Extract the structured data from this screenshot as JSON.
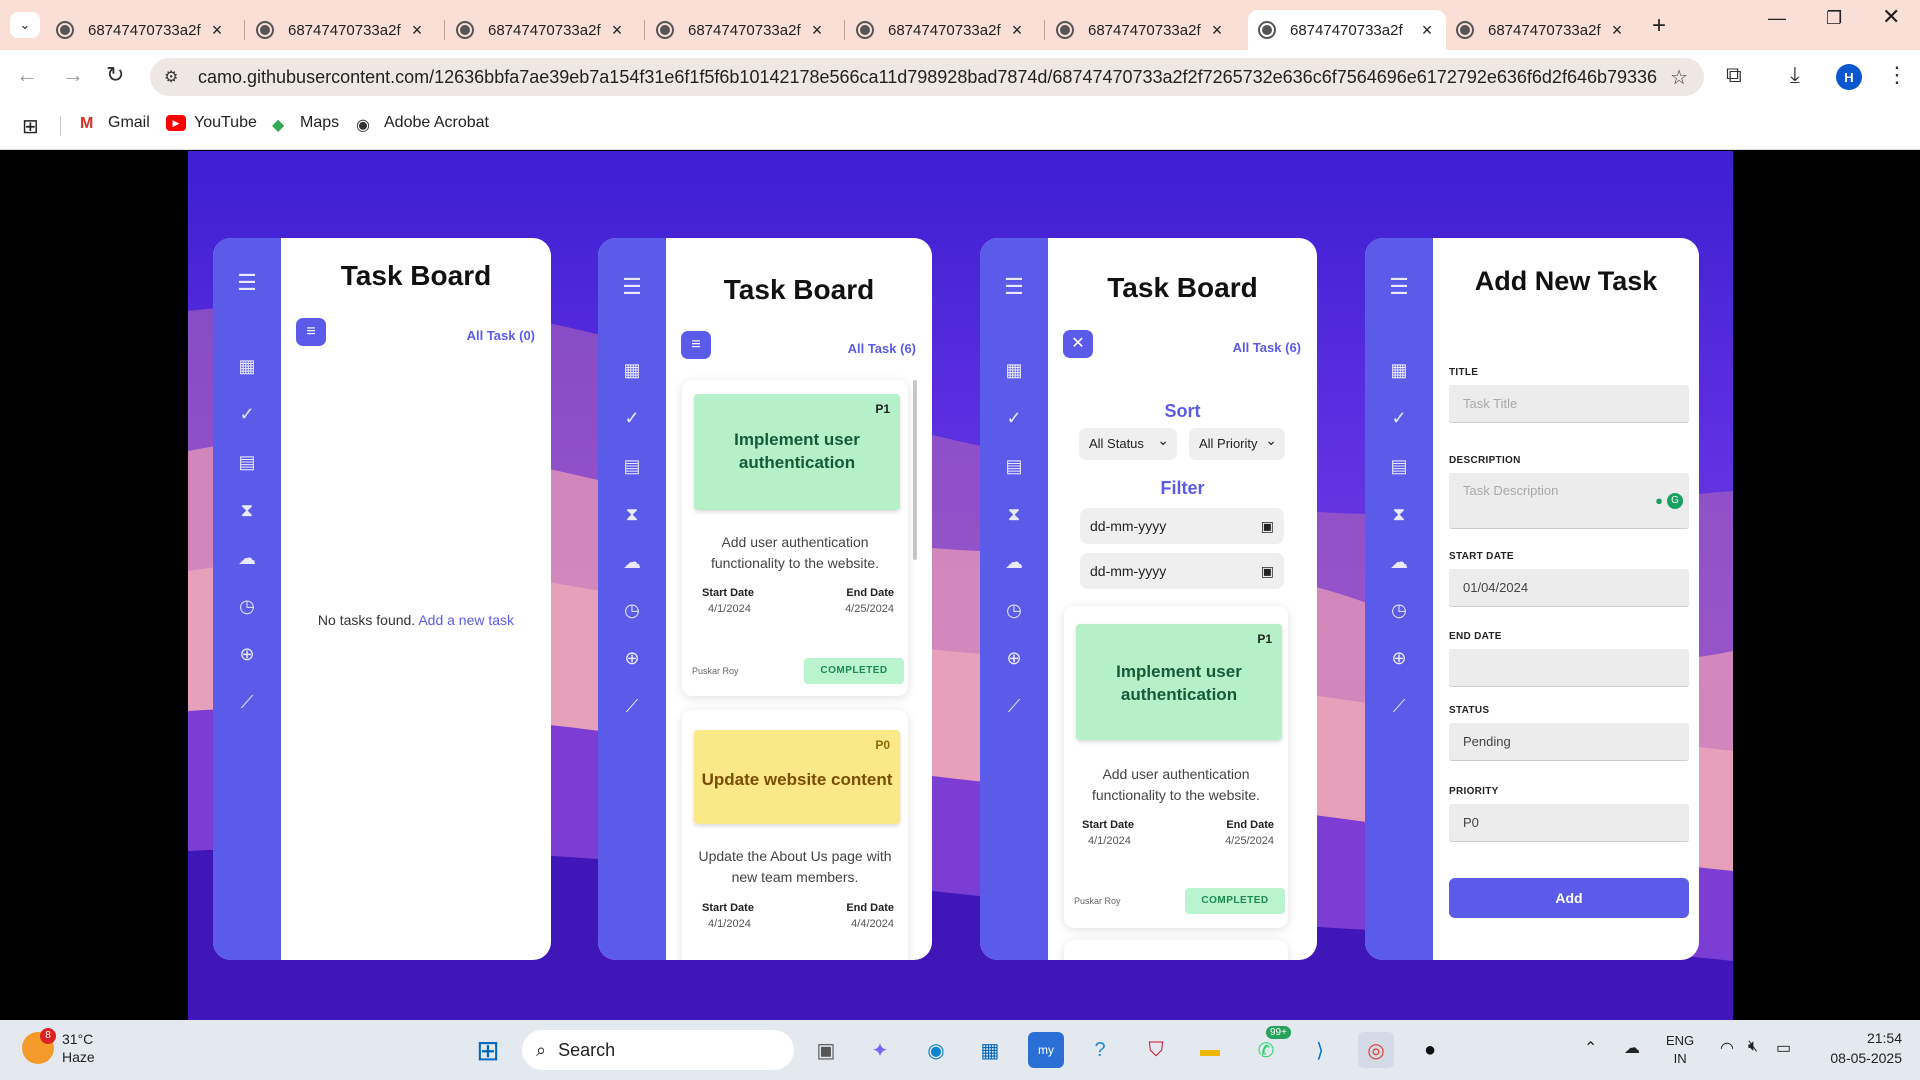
{
  "browser": {
    "tabs": [
      {
        "title": "68747470733a2f"
      },
      {
        "title": "68747470733a2f"
      },
      {
        "title": "68747470733a2f"
      },
      {
        "title": "68747470733a2f"
      },
      {
        "title": "68747470733a2f"
      },
      {
        "title": "68747470733a2f"
      },
      {
        "title": "68747470733a2f",
        "active": true
      },
      {
        "title": "68747470733a2f"
      }
    ],
    "url": "camo.githubusercontent.com/12636bbfa7ae39eb7a154f31e6f1f5f6b10142178e566ca11d798928bad7874d/68747470733a2f2f7265732e636c6f7564696e6172792e636f6d2f646b793363707...",
    "profile_initial": "H",
    "bookmarks": [
      {
        "label": "Gmail",
        "icon": "gmail-icon"
      },
      {
        "label": "YouTube",
        "icon": "youtube-icon"
      },
      {
        "label": "Maps",
        "icon": "maps-icon"
      },
      {
        "label": "Adobe Acrobat",
        "icon": "acrobat-icon"
      }
    ]
  },
  "panel1": {
    "title": "Task Board",
    "all_task": "All Task (0)",
    "empty_text": "No tasks found.",
    "empty_link": "Add a new task"
  },
  "panel2": {
    "title": "Task Board",
    "all_task": "All Task (6)",
    "cards": [
      {
        "priority": "P1",
        "title": "Implement user authentication",
        "description": "Add user authentication functionality to the website.",
        "start_label": "Start Date",
        "start": "4/1/2024",
        "end_label": "End Date",
        "end": "4/25/2024",
        "owner": "Puskar Roy",
        "status": "COMPLETED",
        "color": "#b6f0c8"
      },
      {
        "priority": "P0",
        "title": "Update website content",
        "description": "Update the About Us page with new team members.",
        "start_label": "Start Date",
        "start": "4/1/2024",
        "end_label": "End Date",
        "end": "4/4/2024",
        "color": "#fbe887"
      }
    ]
  },
  "panel3": {
    "title": "Task Board",
    "all_task": "All Task (6)",
    "sort_heading": "Sort",
    "status_select": "All Status",
    "priority_select": "All Priority",
    "filter_heading": "Filter",
    "date_from": "dd-mm-yyyy",
    "date_to": "dd-mm-yyyy",
    "card": {
      "priority": "P1",
      "title": "Implement user authentication",
      "description": "Add user authentication functionality to the website.",
      "start_label": "Start Date",
      "start": "4/1/2024",
      "end_label": "End Date",
      "end": "4/25/2024",
      "owner": "Puskar Roy",
      "status": "COMPLETED"
    }
  },
  "panel4": {
    "title": "Add New Task",
    "title_label": "TITLE",
    "title_placeholder": "Task Title",
    "description_label": "DESCRIPTION",
    "description_placeholder": "Task Description",
    "start_label": "START DATE",
    "start_value": "01/04/2024",
    "end_label": "END DATE",
    "end_value": "",
    "status_label": "STATUS",
    "status_value": "Pending",
    "priority_label": "PRIORITY",
    "priority_value": "P0",
    "add_button": "Add"
  },
  "taskbar": {
    "weather_badge": "8",
    "temperature": "31°C",
    "condition": "Haze",
    "search": "Search",
    "whatsapp_badge": "99+",
    "lang1": "ENG",
    "lang2": "IN",
    "time": "21:54",
    "date": "08-05-2025"
  },
  "colors": {
    "accent": "#5b5bea",
    "completed_bg": "#b9f4cf",
    "completed_text": "#1c8a4f"
  }
}
